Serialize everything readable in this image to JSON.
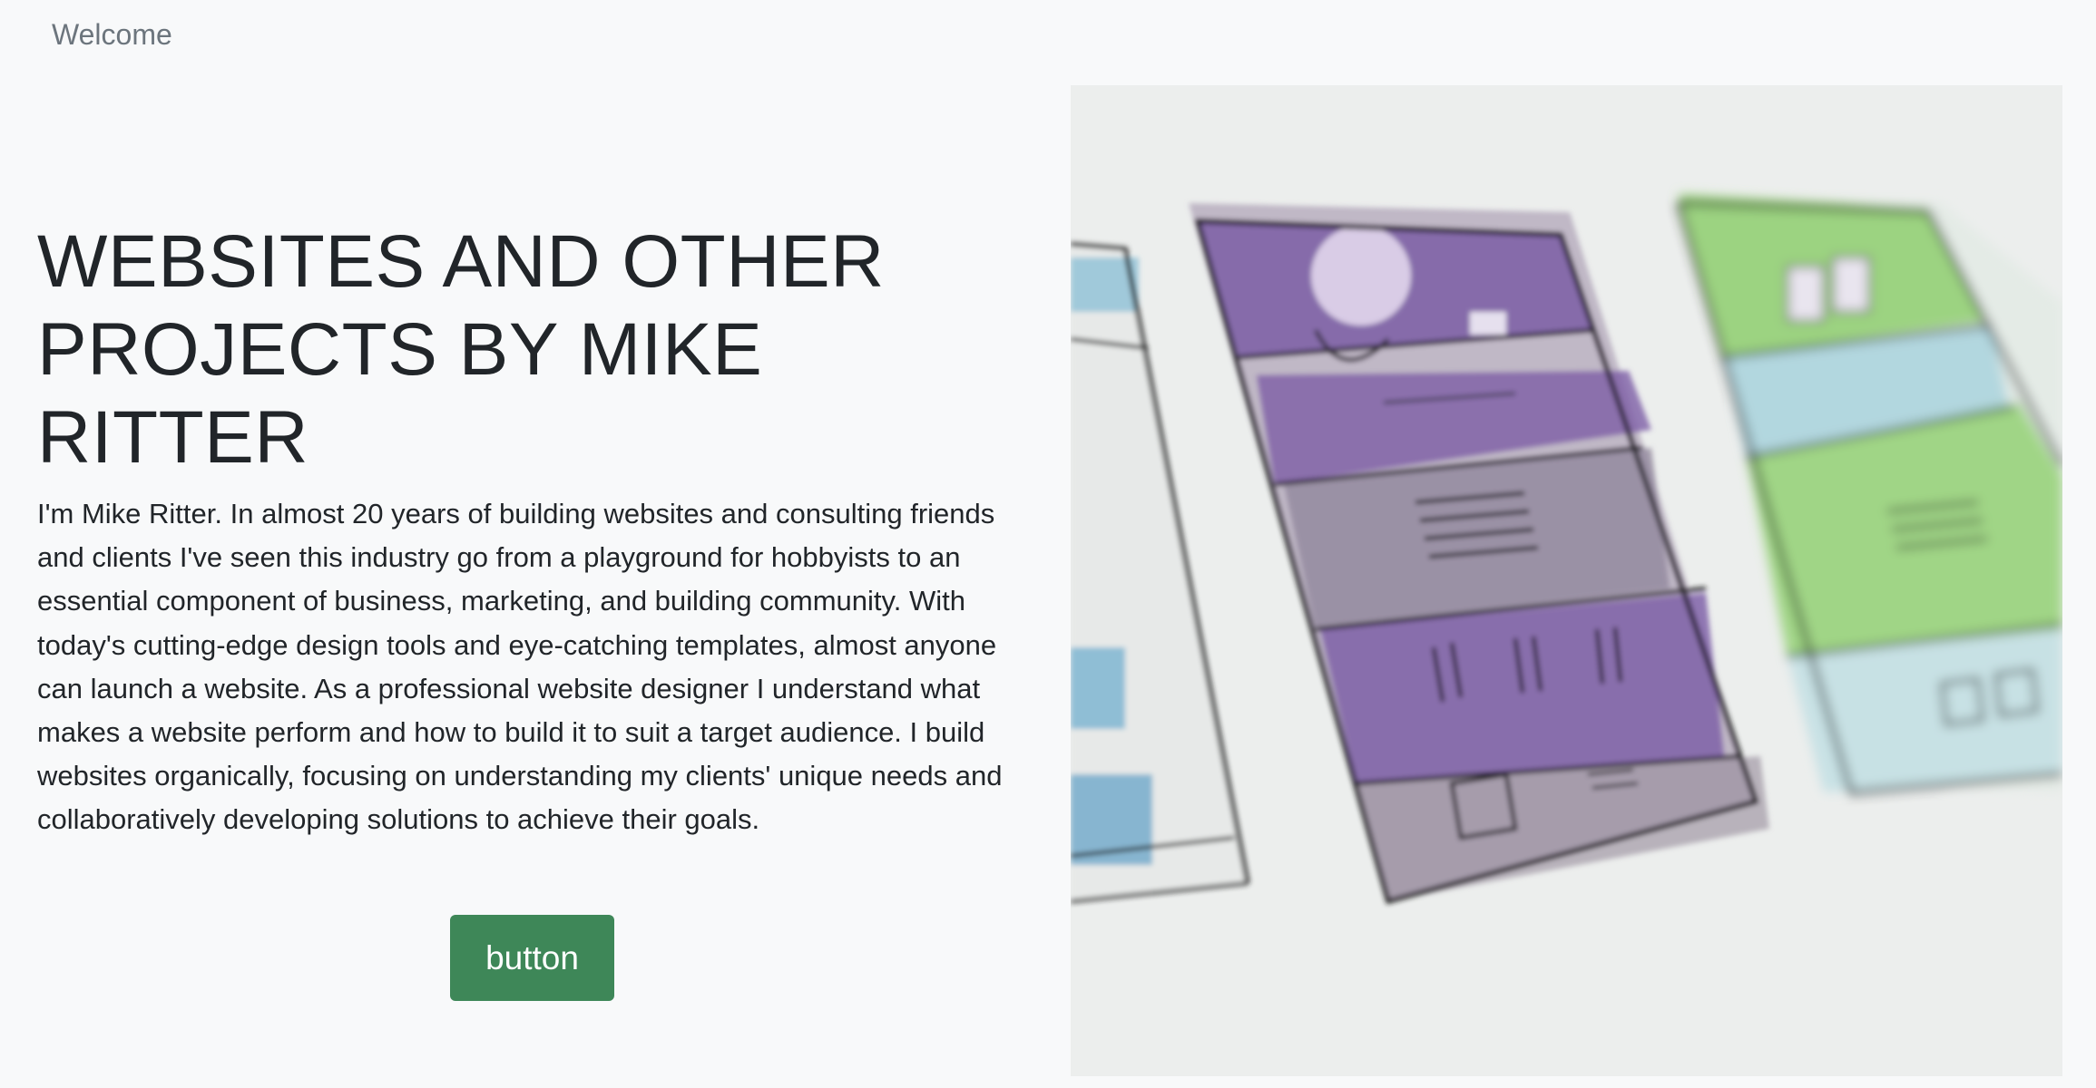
{
  "navbar": {
    "brand": "Welcome"
  },
  "hero": {
    "title": "WEBSITES AND OTHER PROJECTS BY MIKE RITTER",
    "bio": "I'm Mike Ritter. In almost 20 years of building websites and consulting friends and clients I've seen this industry go from a playground for hobbyists to an essential component of business, marketing, and building community. With today's cutting-edge design tools and eye-catching templates, almost anyone can launch a website. As a professional website designer I understand what makes a website perform and how to build it to suit a target audience. I build websites organically, focusing on understanding my clients' unique needs and collaboratively developing solutions to achieve their goals.",
    "button_label": "button",
    "image_alt": "watercolor website wireframe sketches"
  },
  "colors": {
    "background": "#f8f9fa",
    "button": "#3e8758",
    "brand_text": "#6c757d",
    "sketch_purple": "#7d5ea6",
    "sketch_green": "#8fcf6e",
    "sketch_blue": "#a9d3dd"
  }
}
